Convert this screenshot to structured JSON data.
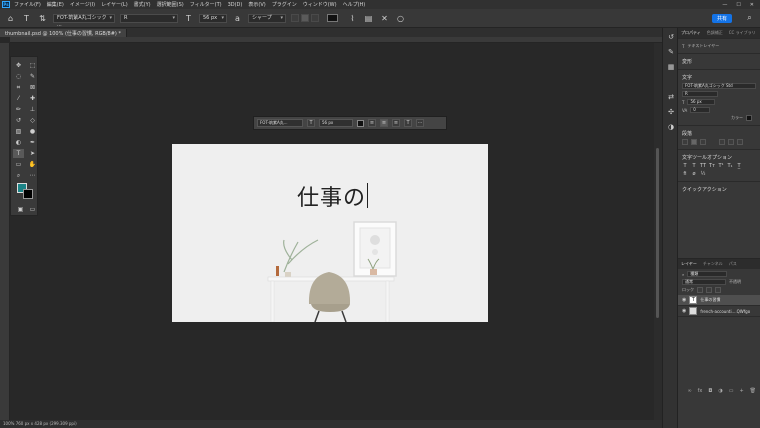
{
  "menubar": {
    "logo": "Ps",
    "items": [
      "ファイル(F)",
      "編集(E)",
      "イメージ(I)",
      "レイヤー(L)",
      "書式(Y)",
      "選択範囲(S)",
      "フィルター(T)",
      "3D(D)",
      "表示(V)",
      "プラグイン",
      "ウィンドウ(W)",
      "ヘルプ(H)"
    ],
    "controls": [
      "—",
      "☐",
      "✕"
    ]
  },
  "options": {
    "font_family": "FOT-筑紫A丸ゴシック ...",
    "font_style": "R",
    "font_size": "56 px",
    "antialias": "シャープ",
    "share": "共有"
  },
  "document": {
    "tab": "thumbnail.psd @ 100% (仕事の習慣, RGB/8#) *",
    "status": "100%    760 px x 428 px (299.309 ppi)"
  },
  "context_bar": {
    "font": "FOT-筑紫A丸...",
    "size": "56 px",
    "more": "···"
  },
  "canvas": {
    "text": "仕事の"
  },
  "colors": {
    "foreground": "#1c8487",
    "background": "#000000",
    "accent": "#1473e6"
  },
  "panel": {
    "tabs": [
      "プロパティ",
      "色調補正",
      "CC ライブラリ"
    ],
    "layer_kind": "テキストレイヤー",
    "transform": "変形",
    "character": "文字",
    "font": "FOT-筑紫A丸ゴシック Std",
    "style": "R",
    "size": "56 px",
    "tracking": "0",
    "color_label": "カラー",
    "paragraph": "段落",
    "type_options": "文字ツールオプション",
    "quick_actions": "クイックアクション"
  },
  "layers": {
    "tabs": [
      "レイヤー",
      "チャンネル",
      "パス"
    ],
    "search": "種類",
    "blend": "通常",
    "opacity_label": "不透明",
    "lock_label": "ロック",
    "items": [
      {
        "name": "仕事の習慣",
        "thumb": "T"
      },
      {
        "name": "french-accounti....QWfgo"
      }
    ]
  }
}
